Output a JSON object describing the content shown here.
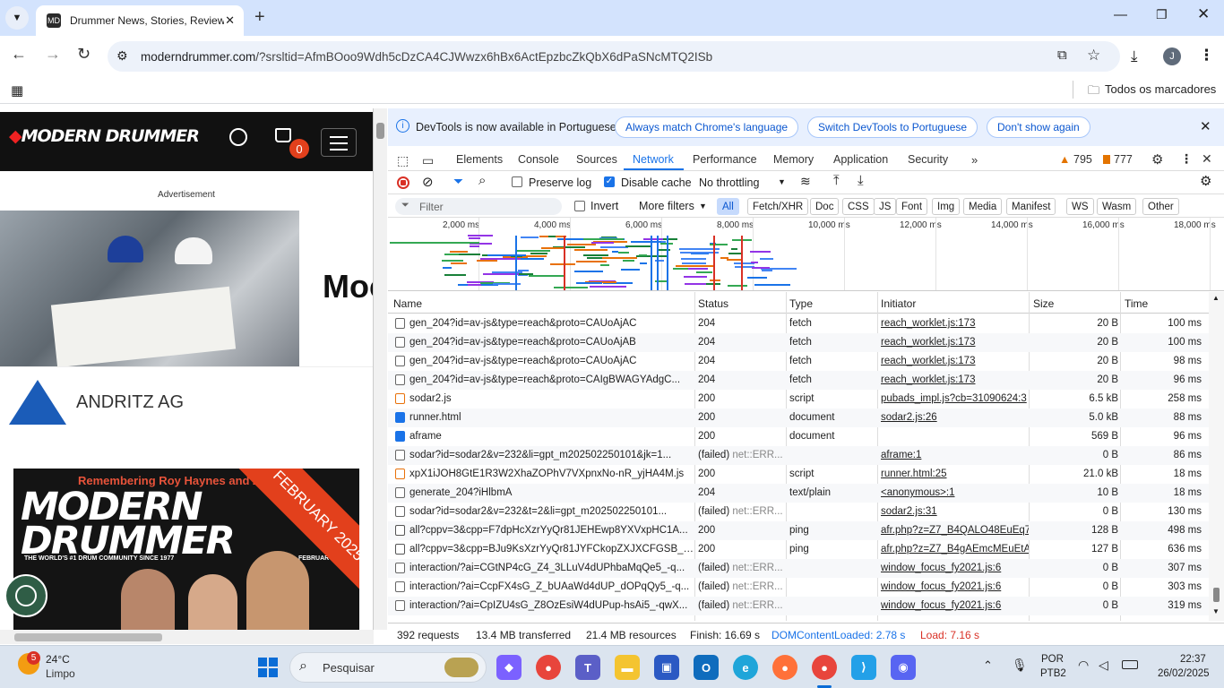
{
  "browser": {
    "tab_title": "Drummer News, Stories, Review",
    "tab_favicon": "MD",
    "url_host": "moderndrummer.com",
    "url_path": "/?srsltid=AfmBOoo9Wdh5cDzCA4CJWwzx6hBx6ActEpzbcZkQbX6dPaSNcMTQ2ISb",
    "profile_initial": "J",
    "bookmarks_label": "Todos os marcadores"
  },
  "page": {
    "cart_count": "0",
    "ad_label": "Advertisement",
    "ad_title": "Moc",
    "company_name": "ANDRITZ AG",
    "magazine_tagline": "Remembering Roy Haynes and Zakir",
    "magazine_title": "MODERN DRUMMER",
    "magazine_subtitle": "THE WORLD'S #1 DRUM COMMUNITY SINCE 1977",
    "magazine_issue": "FEBRUARY",
    "magazine_banner": "FEBRUARY 2025"
  },
  "devtools": {
    "info_text": "DevTools is now available in Portuguese!",
    "info_buttons": [
      "Always match Chrome's language",
      "Switch DevTools to Portuguese",
      "Don't show again"
    ],
    "panel_tabs": [
      "Elements",
      "Console",
      "Sources",
      "Network",
      "Performance",
      "Memory",
      "Application",
      "Security"
    ],
    "active_panel": "Network",
    "warnings": "795",
    "errors": "777",
    "preserve_log": "Preserve log",
    "disable_cache": "Disable cache",
    "throttling": "No throttling",
    "filter_placeholder": "Filter",
    "invert": "Invert",
    "more_filters": "More filters",
    "type_filters": [
      "All",
      "Fetch/XHR",
      "Doc",
      "CSS",
      "JS",
      "Font",
      "Img",
      "Media",
      "Manifest",
      "WS",
      "Wasm",
      "Other"
    ],
    "timeline_ticks": [
      "2,000 ms",
      "4,000 ms",
      "6,000 ms",
      "8,000 ms",
      "10,000 ms",
      "12,000 ms",
      "14,000 ms",
      "16,000 ms",
      "18,000 ms"
    ],
    "columns": [
      "Name",
      "Status",
      "Type",
      "Initiator",
      "Size",
      "Time"
    ],
    "requests": [
      {
        "name": "gen_204?id=av-js&type=reach&proto=CAUoAjAC",
        "status": "204",
        "type": "fetch",
        "initiator": "reach_worklet.js:173",
        "size": "20 B",
        "time": "100 ms",
        "icon": "fetch"
      },
      {
        "name": "gen_204?id=av-js&type=reach&proto=CAUoAjAB",
        "status": "204",
        "type": "fetch",
        "initiator": "reach_worklet.js:173",
        "size": "20 B",
        "time": "100 ms",
        "icon": "fetch"
      },
      {
        "name": "gen_204?id=av-js&type=reach&proto=CAUoAjAC",
        "status": "204",
        "type": "fetch",
        "initiator": "reach_worklet.js:173",
        "size": "20 B",
        "time": "98 ms",
        "icon": "fetch"
      },
      {
        "name": "gen_204?id=av-js&type=reach&proto=CAIgBWAGYAdgC...",
        "status": "204",
        "type": "fetch",
        "initiator": "reach_worklet.js:173",
        "size": "20 B",
        "time": "96 ms",
        "icon": "fetch"
      },
      {
        "name": "sodar2.js",
        "status": "200",
        "type": "script",
        "initiator": "pubads_impl.js?cb=31090624:3",
        "size": "6.5 kB",
        "time": "258 ms",
        "icon": "script"
      },
      {
        "name": "runner.html",
        "status": "200",
        "type": "document",
        "initiator": "sodar2.js:26",
        "size": "5.0 kB",
        "time": "88 ms",
        "icon": "doc"
      },
      {
        "name": "aframe",
        "status": "200",
        "type": "document",
        "initiator": "",
        "size": "569 B",
        "time": "96 ms",
        "icon": "doc"
      },
      {
        "name": "sodar?id=sodar2&v=232&li=gpt_m202502250101&jk=1...",
        "status": "(failed)",
        "status_detail": "net::ERR...",
        "type": "",
        "initiator": "aframe:1",
        "size": "0 B",
        "time": "86 ms",
        "icon": "fetch"
      },
      {
        "name": "xpX1iJOH8GtE1R3W2XhaZOPhV7VXpnxNo-nR_yjHA4M.js",
        "status": "200",
        "type": "script",
        "initiator": "runner.html:25",
        "size": "21.0 kB",
        "time": "18 ms",
        "icon": "script"
      },
      {
        "name": "generate_204?iHlbmA",
        "status": "204",
        "type": "text/plain",
        "initiator": "<anonymous>:1",
        "size": "10 B",
        "time": "18 ms",
        "icon": "fetch"
      },
      {
        "name": "sodar?id=sodar2&v=232&t=2&li=gpt_m202502250101...",
        "status": "(failed)",
        "status_detail": "net::ERR...",
        "type": "",
        "initiator": "sodar2.js:31",
        "size": "0 B",
        "time": "130 ms",
        "icon": "fetch"
      },
      {
        "name": "all?cppv=3&cpp=F7dpHcXzrYyQr81JEHEwp8YXVxpHC1A...",
        "status": "200",
        "type": "ping",
        "initiator": "afr.php?z=Z7_B4QALO48EuEq7",
        "size": "128 B",
        "time": "498 ms",
        "icon": "ping"
      },
      {
        "name": "all?cppv=3&cpp=BJu9KsXzrYyQr81JYFCkopZXJXCFGSB_B...",
        "status": "200",
        "type": "ping",
        "initiator": "afr.php?z=Z7_B4gAEmcMEuEtA",
        "size": "127 B",
        "time": "636 ms",
        "icon": "ping"
      },
      {
        "name": "interaction/?ai=CGtNP4cG_Z4_3LLuV4dUPhbaMqQe5_-q...",
        "status": "(failed)",
        "status_detail": "net::ERR...",
        "type": "",
        "initiator": "window_focus_fy2021.js:6",
        "size": "0 B",
        "time": "307 ms",
        "icon": "fetch"
      },
      {
        "name": "interaction/?ai=CcpFX4sG_Z_bUAaWd4dUP_dOPqQy5_-q...",
        "status": "(failed)",
        "status_detail": "net::ERR...",
        "type": "",
        "initiator": "window_focus_fy2021.js:6",
        "size": "0 B",
        "time": "303 ms",
        "icon": "fetch"
      },
      {
        "name": "interaction/?ai=CpIZU4sG_Z8OzEsiW4dUPup-hsAi5_-qwX...",
        "status": "(failed)",
        "status_detail": "net::ERR...",
        "type": "",
        "initiator": "window_focus_fy2021.js:6",
        "size": "0 B",
        "time": "319 ms",
        "icon": "fetch"
      }
    ],
    "summary": {
      "requests": "392 requests",
      "transferred": "13.4 MB transferred",
      "resources": "21.4 MB resources",
      "finish": "Finish: 16.69 s",
      "dcl": "DOMContentLoaded: 2.78 s",
      "load": "Load: 7.16 s"
    },
    "colors": {
      "dcl": "#1a73e8",
      "load": "#d93025",
      "accent": "#1a73e8"
    }
  },
  "taskbar": {
    "weather_temp": "24°C",
    "weather_desc": "Limpo",
    "weather_badge": "5",
    "search_placeholder": "Pesquisar",
    "lang": "POR",
    "layout": "PTB2",
    "time": "22:37",
    "date": "26/02/2025"
  }
}
